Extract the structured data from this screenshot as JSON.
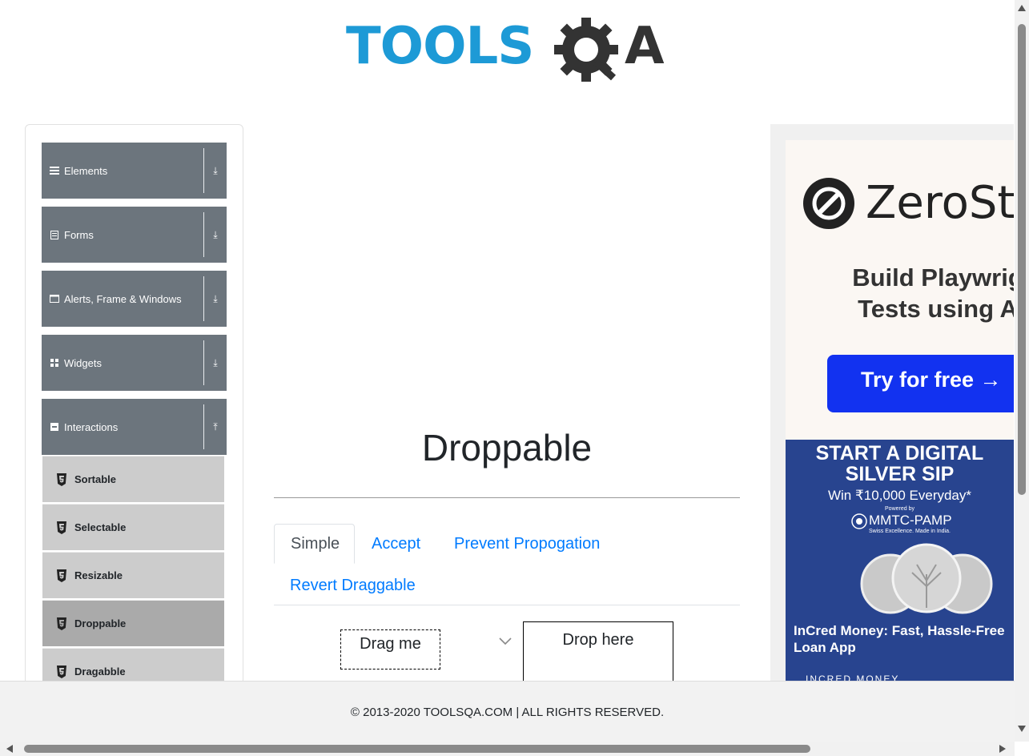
{
  "header": {
    "logo_part1": "TOOLS",
    "logo_part2": "A",
    "brand_colors": {
      "blue": "#1d9ad6",
      "dark": "#333333"
    }
  },
  "sidebar": {
    "groups": [
      {
        "label": "Elements",
        "icon": "hamburger-icon",
        "arrow": "⤓"
      },
      {
        "label": "Forms",
        "icon": "form-icon",
        "arrow": "⤓"
      },
      {
        "label": "Alerts, Frame & Windows",
        "icon": "window-icon",
        "arrow": "⤓"
      },
      {
        "label": "Widgets",
        "icon": "widgets-icon",
        "arrow": "⤓"
      },
      {
        "label": "Interactions",
        "icon": "interactions-icon",
        "arrow": "⤒"
      }
    ],
    "items": [
      {
        "label": "Sortable"
      },
      {
        "label": "Selectable"
      },
      {
        "label": "Resizable"
      },
      {
        "label": "Droppable",
        "active": true
      },
      {
        "label": "Dragabble"
      }
    ]
  },
  "main": {
    "title": "Droppable",
    "tabs": [
      {
        "label": "Simple",
        "active": true
      },
      {
        "label": "Accept"
      },
      {
        "label": "Prevent Propogation"
      },
      {
        "label": "Revert Draggable"
      }
    ],
    "drag_label": "Drag me",
    "drop_label": "Drop here"
  },
  "ad": {
    "brand": "ZeroSte",
    "tagline_1": "Build Playwrig",
    "tagline_2": "Tests using A",
    "cta": "Try for free →",
    "banner_title_1": "START A DIGITAL",
    "banner_title_2": "SILVER SIP",
    "banner_win": "Win ₹10,000 Everyday*",
    "banner_powered": "Powered by",
    "banner_partner": "MMTC-PAMP",
    "banner_partner_sub": "Swiss Excellence. Made in India.",
    "banner_headline": "InCred Money: Fast, Hassle-Free Loan App",
    "banner_footer": "INCRED MONEY"
  },
  "footer": {
    "text": "© 2013-2020 TOOLSQA.COM | ALL RIGHTS RESERVED."
  }
}
